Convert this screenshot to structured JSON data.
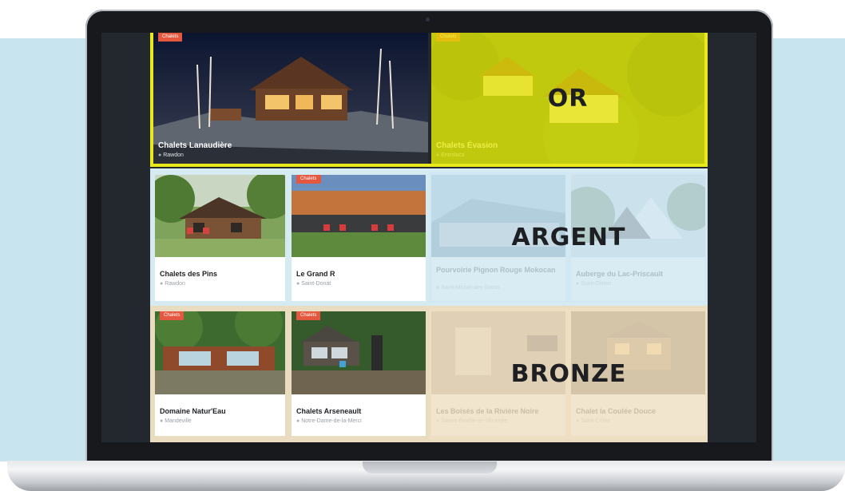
{
  "tiers": {
    "gold": "OR",
    "silver": "ARGENT",
    "bronze": "BRONZE"
  },
  "tag_label": "Chalets",
  "featured": [
    {
      "title": "Chalets Lanaudière",
      "location": "Rawdon"
    },
    {
      "title": "Chalets Évasion",
      "location": "Entrelacs"
    }
  ],
  "silver_listings": [
    {
      "title": "Chalets des Pins",
      "location": "Rawdon"
    },
    {
      "title": "Le Grand R",
      "location": "Saint-Donat"
    },
    {
      "title": "Pourvoirie Pignon Rouge Mokocan",
      "location": "Saint-Michel-des-Saints"
    },
    {
      "title": "Auberge du Lac-Priscault",
      "location": "Saint-Zénon"
    }
  ],
  "bronze_listings": [
    {
      "title": "Domaine Natur'Eau",
      "location": "Mandeville"
    },
    {
      "title": "Chalets Arseneault",
      "location": "Notre-Dame-de-la-Merci"
    },
    {
      "title": "Les Boisés de la Rivière Noire",
      "location": "Sainte-Émélie-de-l'Énergie"
    },
    {
      "title": "Chalet la Coulée Douce",
      "location": "Saint-Côme"
    }
  ],
  "colors": {
    "gold_overlay": "#e6e600",
    "silver_overlay": "#cfe6f0",
    "bronze_overlay": "#efdfc2",
    "tag": "#e5573f",
    "screen_bg": "#23282f"
  }
}
